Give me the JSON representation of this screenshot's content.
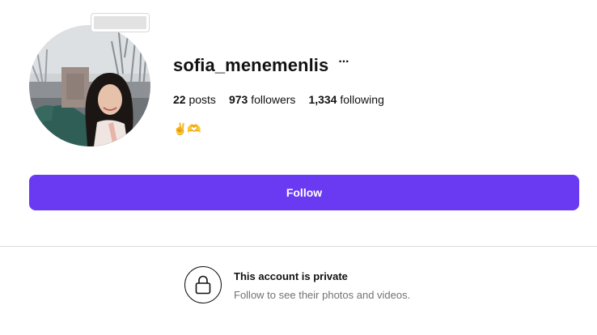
{
  "profile": {
    "username": "sofia_menemenlis",
    "more_icon": "more-horizontal-icon",
    "avatar": "profile-photo",
    "stats": {
      "posts_count": "22",
      "posts_label": "posts",
      "followers_count": "973",
      "followers_label": "followers",
      "following_count": "1,334",
      "following_label": "following"
    },
    "bio": "✌️🫶"
  },
  "actions": {
    "follow_label": "Follow",
    "follow_color": "#6a3af3"
  },
  "private_notice": {
    "icon": "lock-icon",
    "title": "This account is private",
    "subtitle": "Follow to see their photos and videos."
  }
}
